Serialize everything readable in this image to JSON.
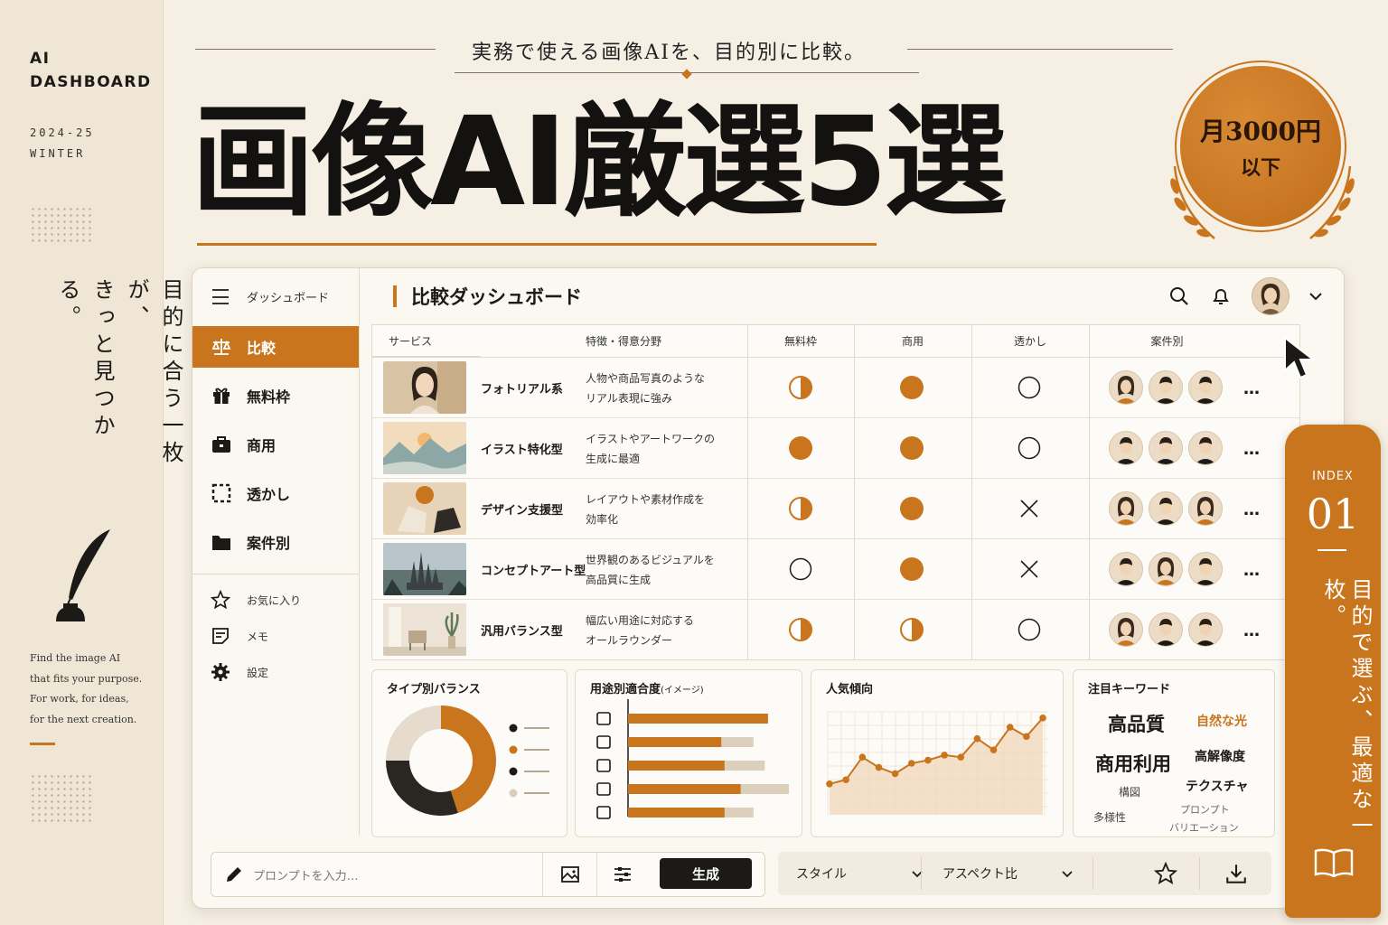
{
  "left": {
    "brand_line1": "AI",
    "brand_line2": "DASHBOARD",
    "season_line1": "2024-25",
    "season_line2": "WINTER",
    "tagline_vertical_1": "目的に合う一枚が、",
    "tagline_vertical_2": "きっと見つかる。",
    "english_lines": [
      "Find the image AI",
      "that fits your purpose.",
      "For work, for ideas,",
      "for the next creation."
    ]
  },
  "header": {
    "subtitle": "実務で使える画像AIを、目的別に比較。",
    "hero_title": "画像AI厳選5選",
    "badge_line1": "月3000円",
    "badge_line2": "以下"
  },
  "sidebar": {
    "header_label": "ダッシュボード",
    "nav": [
      {
        "label": "比較",
        "icon": "scale-icon",
        "active": true
      },
      {
        "label": "無料枠",
        "icon": "gift-icon"
      },
      {
        "label": "商用",
        "icon": "briefcase-icon"
      },
      {
        "label": "透かし",
        "icon": "dashed-square-icon"
      },
      {
        "label": "案件別",
        "icon": "folder-icon"
      }
    ],
    "sub": [
      {
        "label": "お気に入り",
        "icon": "star-icon"
      },
      {
        "label": "メモ",
        "icon": "memo-icon"
      },
      {
        "label": "設定",
        "icon": "gear-icon"
      }
    ]
  },
  "main": {
    "title": "比較ダッシュボード"
  },
  "table": {
    "headers": [
      "サービス",
      "特徴・得意分野",
      "無料枠",
      "商用",
      "透かし",
      "案件別"
    ],
    "rows": [
      {
        "service": "フォトリアル系",
        "desc1": "人物や商品写真のような",
        "desc2": "リアル表現に強み",
        "free": "half",
        "commercial": "full",
        "watermark": "circle",
        "faces": [
          "f",
          "m",
          "m"
        ]
      },
      {
        "service": "イラスト特化型",
        "desc1": "イラストやアートワークの",
        "desc2": "生成に最適",
        "free": "full",
        "commercial": "full",
        "watermark": "circle",
        "faces": [
          "m",
          "m",
          "m"
        ]
      },
      {
        "service": "デザイン支援型",
        "desc1": "レイアウトや素材作成を",
        "desc2": "効率化",
        "free": "half",
        "commercial": "full",
        "watermark": "cross",
        "faces": [
          "f",
          "m",
          "f"
        ]
      },
      {
        "service": "コンセプトアート型",
        "desc1": "世界観のあるビジュアルを",
        "desc2": "高品質に生成",
        "free": "circle",
        "commercial": "full",
        "watermark": "cross",
        "faces": [
          "m",
          "f",
          "m"
        ]
      },
      {
        "service": "汎用バランス型",
        "desc1": "幅広い用途に対応する",
        "desc2": "オールラウンダー",
        "free": "half",
        "commercial": "half",
        "watermark": "circle",
        "faces": [
          "f",
          "m",
          "m"
        ]
      }
    ],
    "more_label": "…"
  },
  "panels": {
    "balance_title": "タイプ別バランス",
    "usage_title": "用途別適合度",
    "usage_note": "(イメージ)",
    "trend_title": "人気傾向",
    "keyword_title": "注目キーワード"
  },
  "chart_data": [
    {
      "type": "pie",
      "title": "タイプ別バランス",
      "values": [
        45,
        30,
        25
      ],
      "colors": [
        "#c8751d",
        "#2a2622",
        "#e6dccd"
      ]
    },
    {
      "type": "bar",
      "title": "用途別適合度",
      "categories": [
        "camera-icon",
        "image-icon",
        "brush-icon",
        "cube-icon",
        "monitor-icon"
      ],
      "series": [
        {
          "values": [
            0.87,
            0.58,
            0.6,
            0.7,
            0.6
          ]
        },
        {
          "values": [
            0.87,
            0.78,
            0.85,
            1.0,
            0.78
          ]
        }
      ]
    },
    {
      "type": "area",
      "title": "人気傾向",
      "values": [
        3,
        3.4,
        5.6,
        4.6,
        4.0,
        5.0,
        5.3,
        5.8,
        5.6,
        7.4,
        6.3,
        8.5,
        7.6,
        9.4
      ]
    }
  ],
  "keywords": [
    {
      "text": "高品質",
      "size": "xl",
      "color": "#1c1a17"
    },
    {
      "text": "自然な光",
      "size": "md",
      "color": "#c8751d"
    },
    {
      "text": "商用利用",
      "size": "xl",
      "color": "#1c1a17"
    },
    {
      "text": "高解像度",
      "size": "sm",
      "color": "#1c1a17"
    },
    {
      "text": "構図",
      "size": "xs",
      "color": "#444"
    },
    {
      "text": "テクスチャ",
      "size": "sm",
      "color": "#1c1a17"
    },
    {
      "text": "多様性",
      "size": "xs",
      "color": "#444"
    },
    {
      "text": "プロンプト",
      "size": "xs",
      "color": "#666"
    },
    {
      "text": "バリエーション",
      "size": "xs",
      "color": "#666"
    }
  ],
  "bottom": {
    "prompt_placeholder": "プロンプトを入力…",
    "generate_label": "生成",
    "style_label": "スタイル",
    "aspect_label": "アスペクト比"
  },
  "index_tab": {
    "label": "INDEX",
    "number": "01",
    "vertical_text": "目的で選ぶ、最適な一枚。"
  },
  "colors": {
    "accent": "#c8751d",
    "ink": "#1c1a17",
    "paper": "#f5efe4"
  }
}
